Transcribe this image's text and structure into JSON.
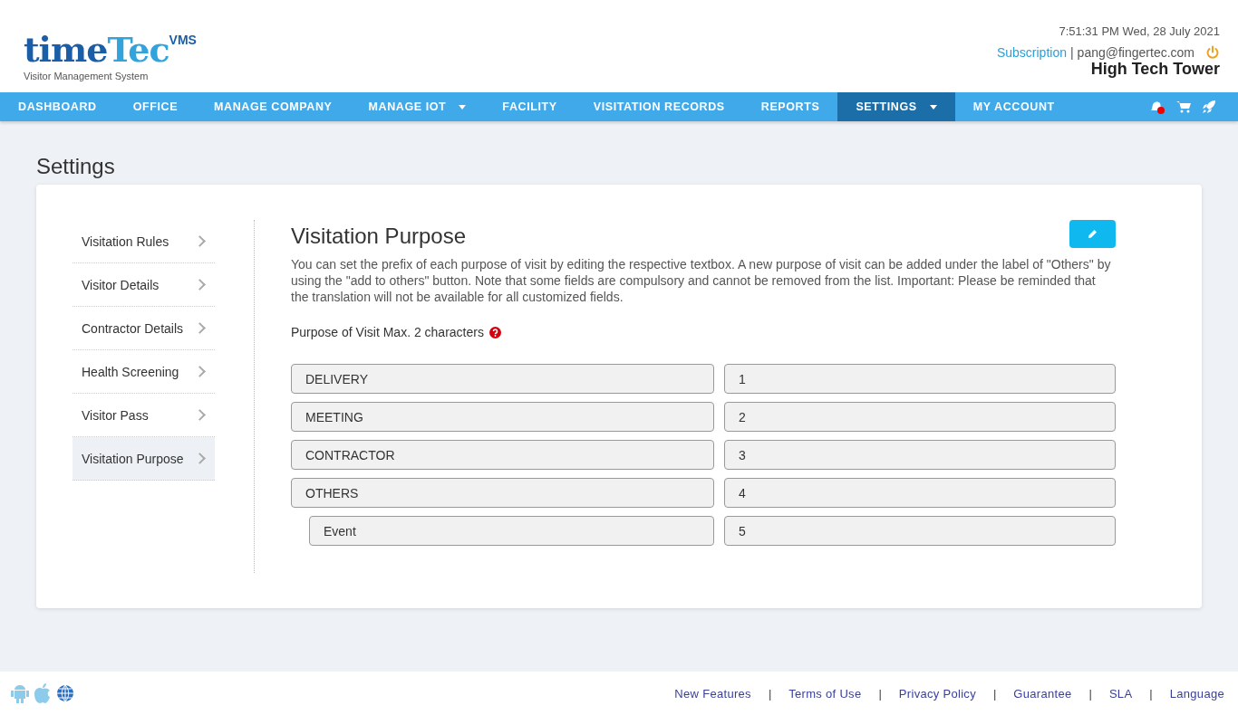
{
  "logo": {
    "word_1": "time",
    "word_2": "Tec",
    "badge": "VMS",
    "tagline": "Visitor Management System"
  },
  "header": {
    "datetime": "7:51:31 PM  Wed, 28 July 2021",
    "subscription": "Subscription",
    "separator": "|",
    "email": "pang@fingertec.com",
    "building": "High Tech Tower"
  },
  "nav": [
    {
      "label": "DASHBOARD",
      "selected": false,
      "dropdown": false
    },
    {
      "label": "OFFICE",
      "selected": false,
      "dropdown": false
    },
    {
      "label": "MANAGE COMPANY",
      "selected": false,
      "dropdown": false
    },
    {
      "label": "MANAGE IOT",
      "selected": false,
      "dropdown": true
    },
    {
      "label": "FACILITY",
      "selected": false,
      "dropdown": false
    },
    {
      "label": "VISITATION RECORDS",
      "selected": false,
      "dropdown": false
    },
    {
      "label": "REPORTS",
      "selected": false,
      "dropdown": false
    },
    {
      "label": "SETTINGS",
      "selected": true,
      "dropdown": true
    },
    {
      "label": "MY ACCOUNT",
      "selected": false,
      "dropdown": false
    }
  ],
  "page_title": "Settings",
  "sidebar": [
    {
      "label": "Visitation Rules",
      "selected": false
    },
    {
      "label": "Visitor Details",
      "selected": false
    },
    {
      "label": "Contractor Details",
      "selected": false
    },
    {
      "label": "Health Screening",
      "selected": false
    },
    {
      "label": "Visitor Pass",
      "selected": false
    },
    {
      "label": "Visitation Purpose",
      "selected": true
    }
  ],
  "content": {
    "title": "Visitation Purpose",
    "description": "You can set the prefix of each purpose of visit by editing the respective textbox. A new purpose of visit can be added under the label of \"Others\" by using the \"add to others\" button. Note that some fields are compulsory and cannot be removed from the list. Important: Please be reminded that the translation will not be available for all customized fields.",
    "field_label": "Purpose of Visit Max. 2 characters",
    "purposes": [
      {
        "name": "DELIVERY",
        "prefix": "1"
      },
      {
        "name": "MEETING",
        "prefix": "2"
      },
      {
        "name": "CONTRACTOR",
        "prefix": "3"
      },
      {
        "name": "OTHERS",
        "prefix": "4",
        "children": [
          {
            "name": "Event",
            "prefix": "5"
          }
        ]
      }
    ]
  },
  "footer": {
    "links": [
      "New Features",
      "Terms of Use",
      "Privacy Policy",
      "Guarantee",
      "SLA",
      "Language"
    ],
    "separator": "|"
  }
}
